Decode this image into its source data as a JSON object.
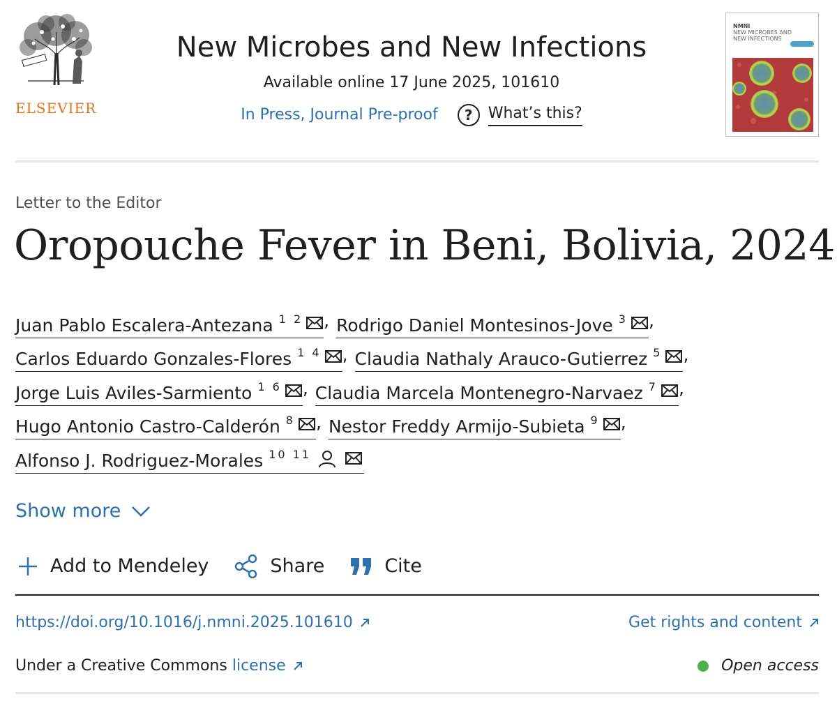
{
  "header": {
    "publisher_logo_text": "ELSEVIER",
    "journal_title": "New Microbes and New Infections",
    "availability": "Available online 17 June 2025, 101610",
    "press_status": "In Press, Journal Pre-proof",
    "whats_this": "What’s this?",
    "cover": {
      "label_line1": "NMNI",
      "label_line2": "NEW MICROBES AND",
      "label_line3": "NEW INFECTIONS"
    }
  },
  "article": {
    "type": "Letter to the Editor",
    "title": "Oropouche Fever in Beni, Bolivia, 2024"
  },
  "authors": [
    {
      "name": "Juan Pablo Escalera-Antezana",
      "affiliations": "1 2",
      "corresponding": false
    },
    {
      "name": "Rodrigo Daniel Montesinos-Jove",
      "affiliations": "3",
      "corresponding": false
    },
    {
      "name": "Carlos Eduardo Gonzales-Flores",
      "affiliations": "1 4",
      "corresponding": false
    },
    {
      "name": "Claudia Nathaly Arauco-Gutierrez",
      "affiliations": "5",
      "corresponding": false
    },
    {
      "name": "Jorge Luis Aviles-Sarmiento",
      "affiliations": "1 6",
      "corresponding": false
    },
    {
      "name": "Claudia Marcela Montenegro-Narvaez",
      "affiliations": "7",
      "corresponding": false
    },
    {
      "name": "Hugo Antonio Castro-Calderón",
      "affiliations": "8",
      "corresponding": false
    },
    {
      "name": "Nestor Freddy Armijo-Subieta",
      "affiliations": "9",
      "corresponding": false
    },
    {
      "name": "Alfonso J. Rodriguez-Morales",
      "affiliations": "10 11",
      "corresponding": true
    }
  ],
  "show_more": "Show more",
  "actions": {
    "mendeley": "Add to Mendeley",
    "share": "Share",
    "cite": "Cite"
  },
  "links": {
    "doi": "https://doi.org/10.1016/j.nmni.2025.101610",
    "rights": "Get rights and content",
    "license_prefix": "Under a Creative Commons",
    "license_link": "license",
    "open_access": "Open access"
  },
  "colors": {
    "link": "#2e6fad",
    "elsevier_orange": "#e9711c",
    "open_access_dot": "#4caf50"
  }
}
